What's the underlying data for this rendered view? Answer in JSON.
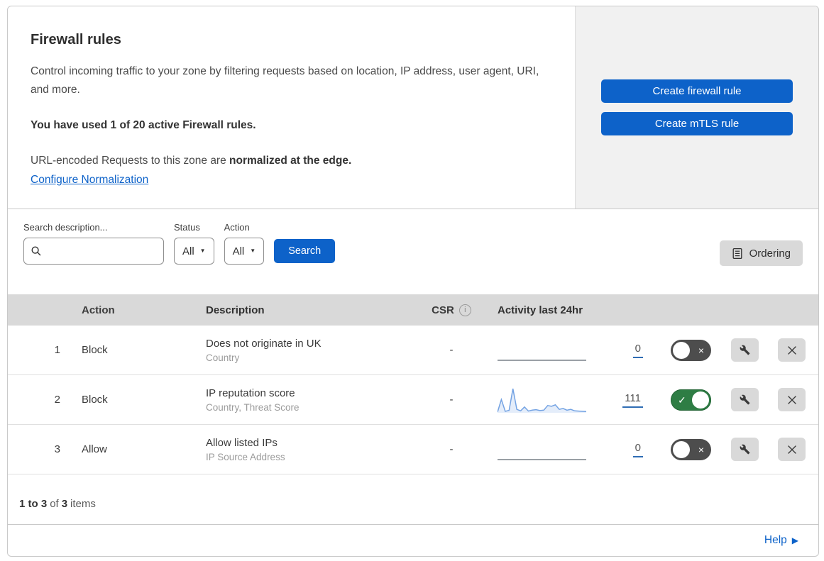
{
  "header": {
    "title": "Firewall rules",
    "description": "Control incoming traffic to your zone by filtering requests based on location, IP address, user agent, URI, and more.",
    "usage": "You have used 1 of 20 active Firewall rules.",
    "normalization_prefix": "URL-encoded Requests to this zone are ",
    "normalization_bold": "normalized at the edge.",
    "normalization_link": "Configure Normalization",
    "create_firewall_label": "Create firewall rule",
    "create_mtls_label": "Create mTLS rule"
  },
  "filters": {
    "search_label": "Search description...",
    "search_value": "",
    "status_label": "Status",
    "status_value": "All",
    "action_label": "Action",
    "action_value": "All",
    "search_button_label": "Search",
    "ordering_button_label": "Ordering"
  },
  "table": {
    "columns": {
      "action": "Action",
      "description": "Description",
      "csr": "CSR",
      "activity": "Activity last 24hr"
    },
    "rows": [
      {
        "priority": "1",
        "action": "Block",
        "description": "Does not originate in UK",
        "fields": "Country",
        "csr": "-",
        "activity_count": "0",
        "enabled": false,
        "sparkline": []
      },
      {
        "priority": "2",
        "action": "Block",
        "description": "IP reputation score",
        "fields": "Country, Threat Score",
        "csr": "-",
        "activity_count": "111",
        "enabled": true,
        "sparkline": [
          3,
          55,
          6,
          10,
          100,
          14,
          8,
          24,
          7,
          11,
          13,
          9,
          11,
          30,
          27,
          33,
          14,
          18,
          11,
          14,
          8,
          7,
          6,
          5
        ]
      },
      {
        "priority": "3",
        "action": "Allow",
        "description": "Allow listed IPs",
        "fields": "IP Source Address",
        "csr": "-",
        "activity_count": "0",
        "enabled": false,
        "sparkline": []
      }
    ]
  },
  "footer": {
    "range": "1 to 3",
    "of": "of",
    "total": "3",
    "items": "items"
  },
  "help": {
    "label": "Help"
  },
  "icons": {
    "chevron_down": "▼",
    "help_arrow": "▶",
    "check": "✓",
    "cross": "×",
    "info": "i"
  },
  "colors": {
    "accent_blue": "#0d62c9",
    "toggle_on_green": "#2e7d44",
    "toggle_off_gray": "#4d4d4d",
    "table_header_gray": "#d9d9d9",
    "panel_gray": "#f1f1f1",
    "sparkline_line": "#74a3e3",
    "sparkline_fill": "#e4edfa"
  }
}
